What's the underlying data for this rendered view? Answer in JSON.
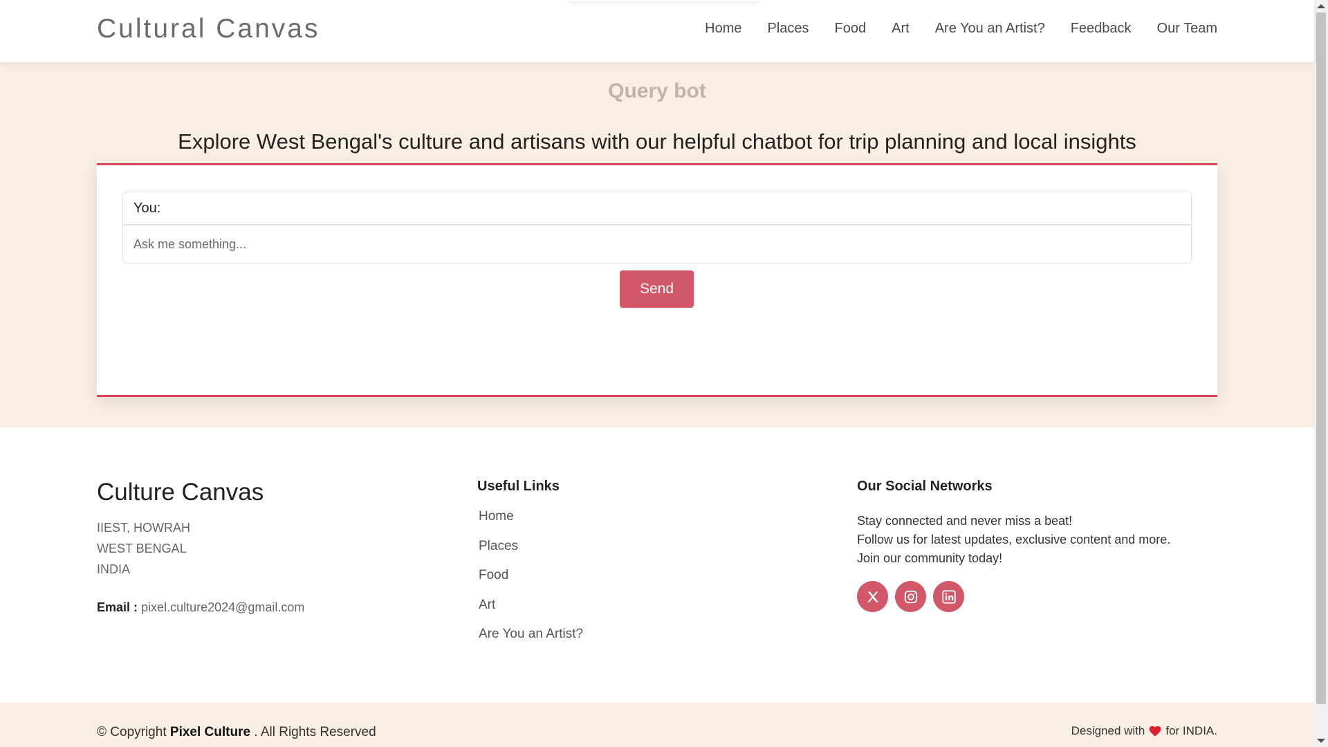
{
  "header": {
    "brand": "Cultural Canvas",
    "nav": [
      "Home",
      "Places",
      "Food",
      "Art",
      "Are You an Artist?",
      "Feedback",
      "Our Team"
    ]
  },
  "main": {
    "title": "Query bot",
    "subtitle": "Explore West Bengal's culture and artisans with our helpful chatbot for trip planning and local insights",
    "chat": {
      "log_label": "You:",
      "input_placeholder": "Ask me something...",
      "send_label": "Send"
    }
  },
  "footer": {
    "brand": "Culture Canvas",
    "address": [
      "IIEST, HOWRAH",
      "WEST BENGAL",
      "INDIA"
    ],
    "email_label": "Email :",
    "email": "pixel.culture2024@gmail.com",
    "useful_links_title": "Useful Links",
    "useful_links": [
      "Home",
      "Places",
      "Food",
      "Art",
      "Are You an Artist?"
    ],
    "social_title": "Our Social Networks",
    "social_text": [
      "Stay connected and never miss a beat!",
      "Follow us for latest updates, exclusive content and more.",
      "Join our community today!"
    ],
    "social_icons": [
      "x-icon",
      "instagram-icon",
      "linkedin-icon"
    ]
  },
  "bottom": {
    "copyright_prefix": "© Copyright",
    "company": "Pixel Culture",
    "copyright_suffix": ". All Rights Reserved",
    "designed_prefix": "Designed with",
    "designed_suffix": "for INDIA."
  },
  "colors": {
    "accent": "#d15769",
    "accent_border": "#d64658",
    "cream": "#f8eee3"
  }
}
